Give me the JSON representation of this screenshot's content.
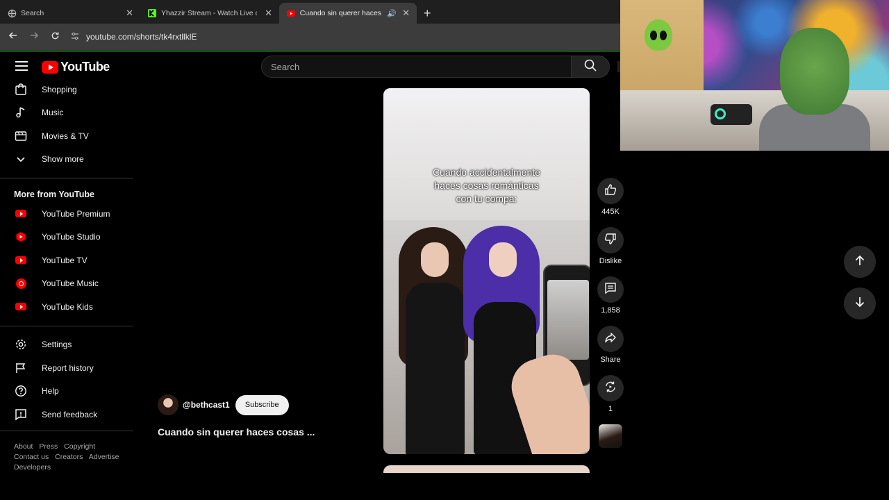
{
  "browser": {
    "tabs": [
      {
        "title": "Search",
        "active": false
      },
      {
        "title": "Yhazzir Stream - Watch Live on",
        "active": false
      },
      {
        "title": "Cuando sin querer haces co",
        "active": true
      }
    ],
    "new_tab": "+",
    "url": "youtube.com/shorts/tk4rxtllklE"
  },
  "header": {
    "logo_text": "YouTube",
    "search_placeholder": "Search"
  },
  "sidebar": {
    "top_items": [
      {
        "label": "Shopping",
        "icon": "shopping-bag-icon"
      },
      {
        "label": "Music",
        "icon": "music-note-icon"
      },
      {
        "label": "Movies & TV",
        "icon": "clapperboard-icon"
      },
      {
        "label": "Show more",
        "icon": "chevron-down-icon"
      }
    ],
    "more_title": "More from YouTube",
    "more_items": [
      {
        "label": "YouTube Premium",
        "icon": "youtube-premium-icon"
      },
      {
        "label": "YouTube Studio",
        "icon": "youtube-studio-icon"
      },
      {
        "label": "YouTube TV",
        "icon": "youtube-tv-icon"
      },
      {
        "label": "YouTube Music",
        "icon": "youtube-music-icon"
      },
      {
        "label": "YouTube Kids",
        "icon": "youtube-kids-icon"
      }
    ],
    "bottom_items": [
      {
        "label": "Settings",
        "icon": "gear-icon"
      },
      {
        "label": "Report history",
        "icon": "flag-icon"
      },
      {
        "label": "Help",
        "icon": "help-icon"
      },
      {
        "label": "Send feedback",
        "icon": "feedback-icon"
      }
    ],
    "footer": {
      "row1": [
        "About",
        "Press",
        "Copyright"
      ],
      "row2": [
        "Contact us",
        "Creators",
        "Advertise"
      ],
      "row3": [
        "Developers"
      ]
    }
  },
  "short": {
    "caption_lines": [
      "Cuando accidentalmente",
      "haces cosas románticas",
      "con tu compa:"
    ],
    "channel_handle": "@bethcast1",
    "subscribe_label": "Subscribe",
    "title": "Cuando sin querer haces cosas ..."
  },
  "actions": {
    "like_count": "445K",
    "dislike_label": "Dislike",
    "comment_count": "1,858",
    "share_label": "Share",
    "remix_count": "1"
  },
  "colors": {
    "brand_red": "#ff0000",
    "background": "#000000",
    "button_bg": "#272727"
  }
}
